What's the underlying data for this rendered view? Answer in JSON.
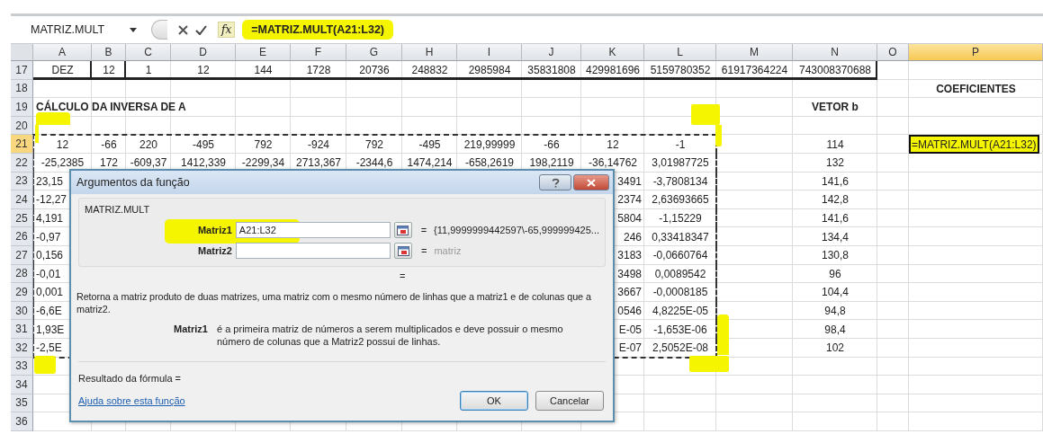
{
  "highlighter_marks": true,
  "formula_bar": {
    "name_box": "MATRIZ.MULT",
    "fx_label": "fx",
    "formula": "=MATRIZ.MULT(A21:L32)"
  },
  "columns": [
    {
      "label": "A",
      "selected": false
    },
    {
      "label": "B",
      "selected": false
    },
    {
      "label": "C",
      "selected": false
    },
    {
      "label": "D",
      "selected": false
    },
    {
      "label": "E",
      "selected": false
    },
    {
      "label": "F",
      "selected": false
    },
    {
      "label": "G",
      "selected": false
    },
    {
      "label": "H",
      "selected": false
    },
    {
      "label": "I",
      "selected": false
    },
    {
      "label": "J",
      "selected": false
    },
    {
      "label": "K",
      "selected": false
    },
    {
      "label": "L",
      "selected": false
    },
    {
      "label": "M",
      "selected": false
    },
    {
      "label": "N",
      "selected": false
    },
    {
      "label": "O",
      "selected": false
    },
    {
      "label": "P",
      "selected": true
    }
  ],
  "rows": [
    {
      "number": "17",
      "selected": false,
      "kind": "bordered",
      "marquee": false,
      "cells": {
        "A": "DEZ",
        "B": "12",
        "C": "1",
        "D": "12",
        "E": "144",
        "F": "1728",
        "G": "20736",
        "H": "248832",
        "I": "2985984",
        "J": "35831808",
        "K": "429981696",
        "L": "5159780352",
        "M": "61917364224",
        "N": "743008370688"
      }
    },
    {
      "number": "18",
      "selected": false,
      "kind": "heading",
      "marquee": false,
      "cells": {
        "P": "COEFICIENTES"
      }
    },
    {
      "number": "19",
      "selected": false,
      "kind": "heading",
      "marquee": false,
      "cells": {
        "A": "CÁLCULO DA INVERSA DE A",
        "N": "VETOR b"
      }
    },
    {
      "number": "20",
      "selected": false,
      "kind": "plain",
      "marquee": false
    },
    {
      "number": "21",
      "selected": true,
      "kind": "plain",
      "marquee": true,
      "cells": {
        "A": "12",
        "B": "-66",
        "C": "220",
        "D": "-495",
        "E": "792",
        "F": "-924",
        "G": "792",
        "H": "-495",
        "I": "219,99999",
        "J": "-66",
        "K": "12",
        "L": "-1",
        "N": "114",
        "P": "=MATRIZ.MULT(A21:L32)"
      }
    },
    {
      "number": "22",
      "selected": false,
      "kind": "plain",
      "marquee": true,
      "cells": {
        "A": "-25,2385",
        "B": "172",
        "C": "-609,37",
        "D": "1412,339",
        "E": "-2299,34",
        "F": "2713,367",
        "G": "-2344,6",
        "H": "1474,214",
        "I": "-658,2619",
        "J": "198,2119",
        "K": "-36,14762",
        "L": "3,01987725",
        "N": "132"
      }
    },
    {
      "number": "23",
      "selected": false,
      "kind": "partial",
      "marquee": true,
      "cells": {
        "A": "23,15",
        "K": "3491",
        "L": "-3,7808134",
        "N": "141,6"
      }
    },
    {
      "number": "24",
      "selected": false,
      "kind": "partial",
      "marquee": true,
      "cells": {
        "A": "-12,27",
        "K": "2374",
        "L": "2,63693665",
        "N": "142,8"
      }
    },
    {
      "number": "25",
      "selected": false,
      "kind": "partial",
      "marquee": true,
      "cells": {
        "A": "4,191",
        "K": "5804",
        "L": "-1,15229",
        "N": "141,6"
      }
    },
    {
      "number": "26",
      "selected": false,
      "kind": "partial",
      "marquee": true,
      "cells": {
        "A": "-0,97",
        "K": "246",
        "L": "0,33418347",
        "N": "134,4"
      }
    },
    {
      "number": "27",
      "selected": false,
      "kind": "partial",
      "marquee": true,
      "cells": {
        "A": "0,156",
        "K": "3183",
        "L": "-0,0660764",
        "N": "130,8"
      }
    },
    {
      "number": "28",
      "selected": false,
      "kind": "partial",
      "marquee": true,
      "cells": {
        "A": "-0,01",
        "K": "3498",
        "L": "0,0089542",
        "N": "96"
      }
    },
    {
      "number": "29",
      "selected": false,
      "kind": "partial",
      "marquee": true,
      "cells": {
        "A": "0,001",
        "K": "3667",
        "L": "-0,0008185",
        "N": "104,4"
      }
    },
    {
      "number": "30",
      "selected": false,
      "kind": "partial",
      "marquee": true,
      "cells": {
        "A": "-6,6E",
        "K": "0546",
        "L": "4,8225E-05",
        "N": "94,8"
      }
    },
    {
      "number": "31",
      "selected": false,
      "kind": "partial",
      "marquee": true,
      "cells": {
        "A": "1,93E",
        "K": "E-05",
        "L": "-1,653E-06",
        "N": "98,4"
      }
    },
    {
      "number": "32",
      "selected": false,
      "kind": "partial",
      "marquee": true,
      "cells": {
        "A": "-2,5E",
        "K": "E-07",
        "L": "2,5052E-08",
        "N": "102"
      }
    },
    {
      "number": "33",
      "selected": false,
      "kind": "plain",
      "marquee": false
    },
    {
      "number": "34",
      "selected": false,
      "kind": "plain",
      "marquee": false
    },
    {
      "number": "35",
      "selected": false,
      "kind": "plain",
      "marquee": false
    },
    {
      "number": "36",
      "selected": false,
      "kind": "plain",
      "marquee": false
    }
  ],
  "dialog": {
    "title": "Argumentos da função",
    "function_name": "MATRIZ.MULT",
    "arguments": [
      {
        "label": "Matriz1",
        "value": "A21:L32",
        "equals": "=",
        "result": "{11,9999999442597\\-65,999999425...",
        "empty": false
      },
      {
        "label": "Matriz2",
        "equals": "=",
        "result": "matriz",
        "empty": true
      }
    ],
    "result_equals": "=",
    "description": "Retorna a matriz produto de duas matrizes, uma matriz com o mesmo número de linhas que a matriz1 e de colunas que a matriz2.",
    "argument_help": {
      "label": "Matriz1",
      "text": "é a primeira matriz de números a serem multiplicados e deve possuir o mesmo número de colunas que a Matriz2 possui de linhas."
    },
    "formula_result": "Resultado da fórmula =",
    "help_link": "Ajuda sobre esta função",
    "buttons": [
      {
        "label": "OK",
        "default": true
      },
      {
        "label": "Cancelar",
        "default": false
      }
    ]
  }
}
